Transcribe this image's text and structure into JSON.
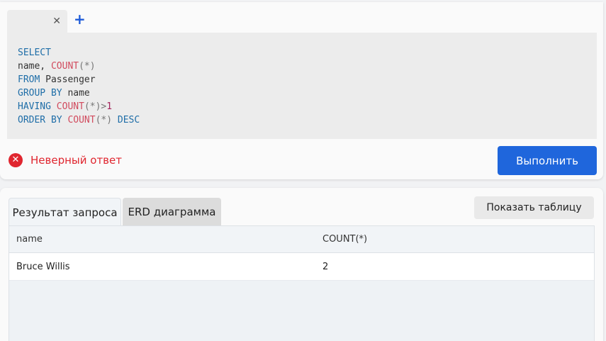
{
  "editor": {
    "tab_close_icon": "close-icon",
    "tab_close_glyph": "✕",
    "add_tab_glyph": "+",
    "code_lines": [
      [
        {
          "t": "SELECT",
          "c": "kw"
        }
      ],
      [
        {
          "t": "name, ",
          "c": ""
        },
        {
          "t": "COUNT",
          "c": "fn"
        },
        {
          "t": "(*)",
          "c": "pun"
        }
      ],
      [
        {
          "t": "FROM",
          "c": "kw"
        },
        {
          "t": " Passenger",
          "c": ""
        }
      ],
      [
        {
          "t": "GROUP BY",
          "c": "kw"
        },
        {
          "t": " name",
          "c": ""
        }
      ],
      [
        {
          "t": "HAVING",
          "c": "kw"
        },
        {
          "t": " ",
          "c": ""
        },
        {
          "t": "COUNT",
          "c": "fn"
        },
        {
          "t": "(*)",
          "c": "pun"
        },
        {
          "t": ">",
          "c": "pun"
        },
        {
          "t": "1",
          "c": "num"
        }
      ],
      [
        {
          "t": "ORDER BY",
          "c": "kw"
        },
        {
          "t": " ",
          "c": ""
        },
        {
          "t": "COUNT",
          "c": "fn"
        },
        {
          "t": "(*)",
          "c": "pun"
        },
        {
          "t": " DESC",
          "c": "kw"
        }
      ]
    ]
  },
  "status": {
    "icon_glyph": "✕",
    "text": "Неверный ответ"
  },
  "run_button": {
    "label": "Выполнить"
  },
  "results": {
    "tabs": [
      {
        "label": "Результат запроса",
        "active": true
      },
      {
        "label": "ERD диаграмма",
        "active": false
      }
    ],
    "show_table_label": "Показать таблицу",
    "columns": [
      "name",
      "COUNT(*)"
    ],
    "rows": [
      [
        "Bruce Willis",
        "2"
      ]
    ]
  },
  "colors": {
    "accent": "#1f66dc",
    "error": "#e0262f"
  }
}
